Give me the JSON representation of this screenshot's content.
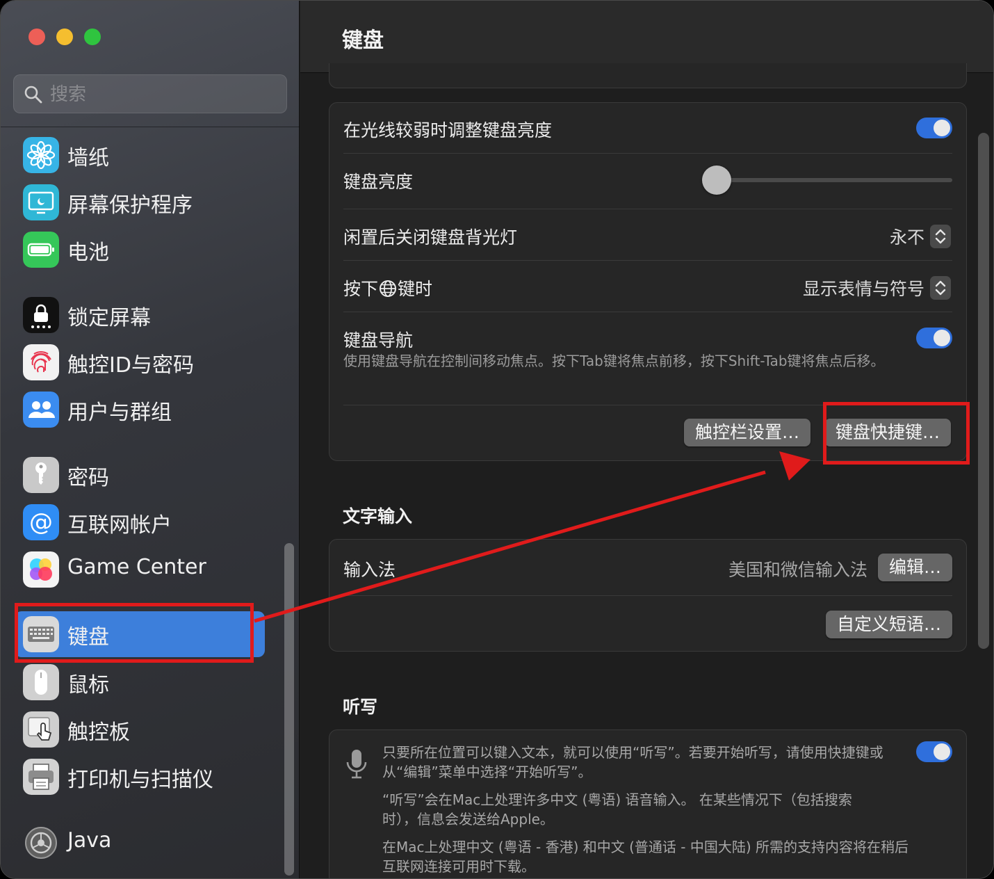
{
  "window": {
    "controls": [
      "close",
      "minimize",
      "maximize"
    ]
  },
  "sidebar": {
    "search": {
      "placeholder": "搜索",
      "value": ""
    },
    "items": [
      {
        "label": "墙纸",
        "icon": "wallpaper-icon"
      },
      {
        "label": "屏幕保护程序",
        "icon": "screensaver-icon"
      },
      {
        "label": "电池",
        "icon": "battery-icon"
      },
      {
        "label": "锁定屏幕",
        "icon": "lock-screen-icon"
      },
      {
        "label": "触控ID与密码",
        "icon": "touch-id-icon"
      },
      {
        "label": "用户与群组",
        "icon": "users-groups-icon"
      },
      {
        "label": "密码",
        "icon": "key-icon"
      },
      {
        "label": "互联网帐户",
        "icon": "at-sign-icon"
      },
      {
        "label": "Game Center",
        "icon": "game-center-icon"
      },
      {
        "label": "键盘",
        "icon": "keyboard-icon",
        "selected": true
      },
      {
        "label": "鼠标",
        "icon": "mouse-icon"
      },
      {
        "label": "触控板",
        "icon": "trackpad-icon"
      },
      {
        "label": "打印机与扫描仪",
        "icon": "printer-icon"
      },
      {
        "label": "Java",
        "icon": "java-icon"
      }
    ]
  },
  "main": {
    "title": "键盘",
    "keyboard_card": {
      "auto_brightness": {
        "label": "在光线较弱时调整键盘亮度",
        "on": true
      },
      "brightness": {
        "label": "键盘亮度",
        "level": 0
      },
      "backlight_off": {
        "label": "闲置后关闭键盘背光灯",
        "value": "永不"
      },
      "globe_key": {
        "label_before": "按下",
        "label_after": "键时",
        "value": "显示表情与符号"
      },
      "keyboard_nav": {
        "label": "键盘导航",
        "description": "使用键盘导航在控制间移动焦点。按下Tab键将焦点前移，按下Shift-Tab键将焦点后移。",
        "on": true
      },
      "touchbar_button": "触控栏设置…",
      "shortcuts_button": "键盘快捷键…"
    },
    "text_input": {
      "title": "文字输入",
      "input_method": {
        "label": "输入法",
        "value": "美国和微信输入法",
        "edit_button": "编辑…"
      },
      "custom_phrases_button": "自定义短语…"
    },
    "dictation": {
      "title": "听写",
      "on": true,
      "para1": "只要所在位置可以键入文本，就可以使用“听写”。若要开始听写，请使用快捷键或从“编辑”菜单中选择“开始听写”。",
      "para2": "“听写”会在Mac上处理许多中文 (粤语) 语音输入。 在某些情况下（包括搜索时），信息会发送给Apple。",
      "para3": "在Mac上处理中文 (粤语 - 香港) 和中文 (普通话 - 中国大陆) 所需的支持内容将在稍后互联网连接可用时下载。"
    }
  },
  "annotation": {
    "color": "#e01b1b"
  }
}
